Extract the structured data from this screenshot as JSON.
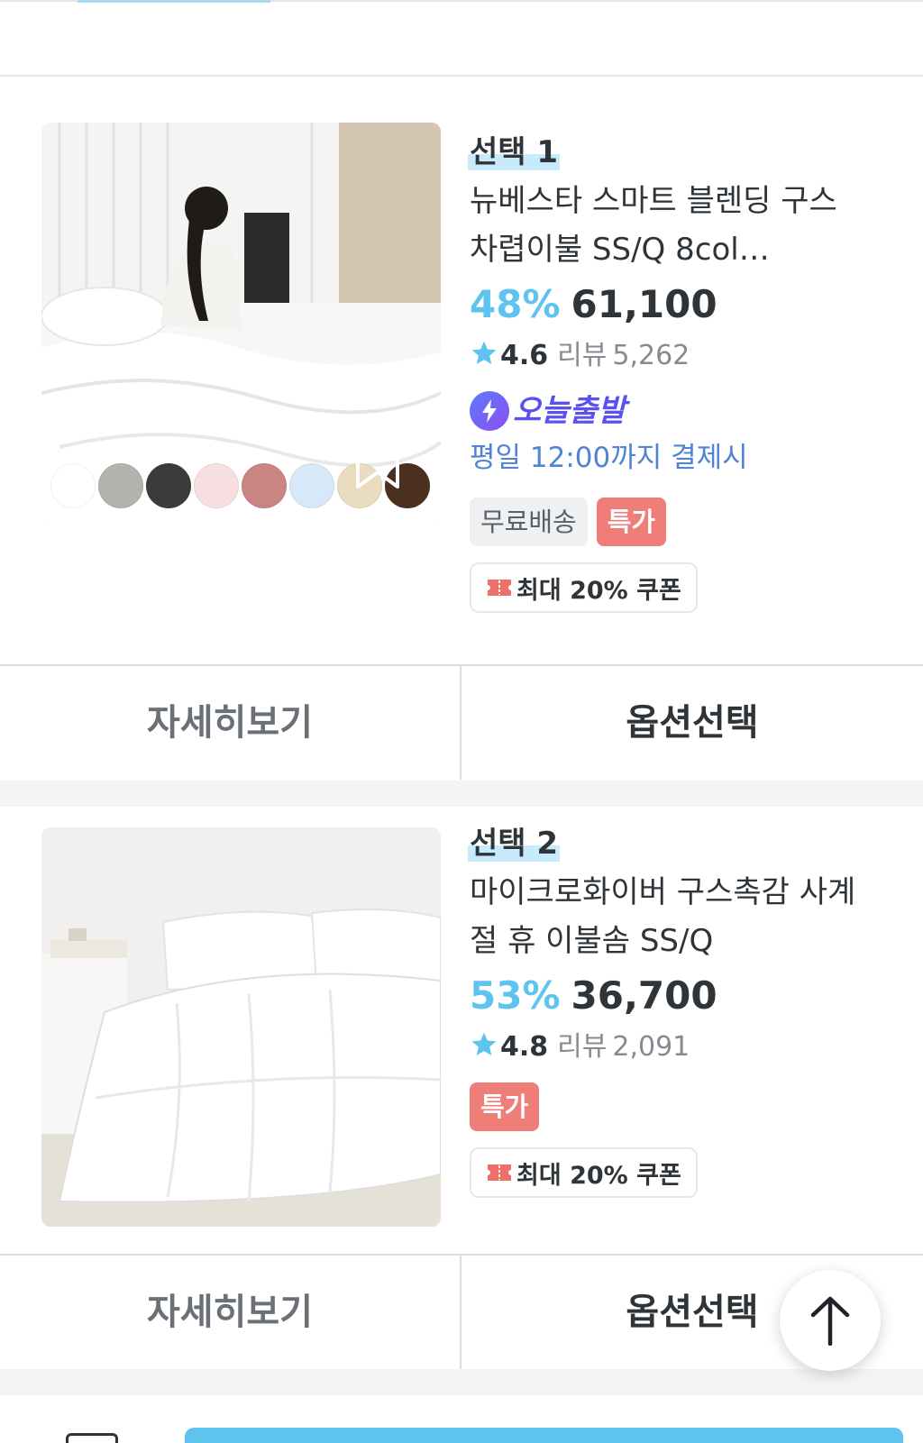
{
  "products": [
    {
      "pick_label": "선택 1",
      "name": "뉴베스타 스마트 블렌딩 구스 차렵이불 SS/Q 8col…",
      "discount": "48%",
      "price": "61,100",
      "rating": "4.6",
      "review_label": "리뷰",
      "review_count": "5,262",
      "delivery_badge": "오늘출발",
      "delivery_note": "평일 12:00까지 결제시",
      "tags": [
        "무료배송",
        "특가"
      ],
      "coupon": "최대 20% 쿠폰",
      "color_swatches": [
        "#ffffff",
        "#b3b2ac",
        "#3b3b3b",
        "#f7dfe1",
        "#c98582",
        "#d7e9f8",
        "#e9dcbf",
        "#4b3020"
      ],
      "detail_label": "자세히보기",
      "option_label": "옵션선택"
    },
    {
      "pick_label": "선택 2",
      "name": "마이크로화이버 구스촉감 사계절 휴 이불솜 SS/Q",
      "discount": "53%",
      "price": "36,700",
      "rating": "4.8",
      "review_label": "리뷰",
      "review_count": "2,091",
      "tags": [
        "특가"
      ],
      "coupon": "최대 20% 쿠폰",
      "detail_label": "자세히보기",
      "option_label": "옵션선택"
    }
  ],
  "icons": {
    "bookmark": "bookmark-icon",
    "star": "star-icon",
    "lightning": "lightning-icon",
    "coupon": "coupon-icon",
    "scroll_top": "arrow-up-icon"
  },
  "colors": {
    "accent": "#5ec3ee",
    "special_badge": "#ef7d78",
    "today_purple": "#5a52f0",
    "deadline_blue": "#4f83d6"
  }
}
